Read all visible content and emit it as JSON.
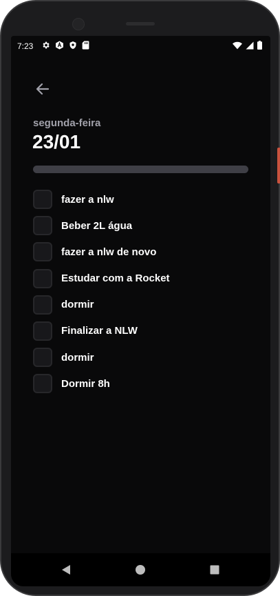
{
  "status_bar": {
    "time": "7:23",
    "left_icons": [
      "gear-icon",
      "a-badge-icon",
      "shield-icon",
      "sd-card-icon"
    ],
    "right_icons": [
      "wifi-icon",
      "signal-icon",
      "battery-icon"
    ]
  },
  "header": {
    "back_icon": "arrow-left-icon",
    "weekday": "segunda-feira",
    "date": "23/01"
  },
  "progress": {
    "value": 0,
    "track_color": "#3f3f46",
    "fill_color": "#7c3aed"
  },
  "habits": [
    {
      "label": "fazer a nlw",
      "checked": false
    },
    {
      "label": "Beber 2L água",
      "checked": false
    },
    {
      "label": "fazer a nlw de novo",
      "checked": false
    },
    {
      "label": "Estudar com a Rocket",
      "checked": false
    },
    {
      "label": "dormir",
      "checked": false
    },
    {
      "label": "Finalizar a NLW",
      "checked": false
    },
    {
      "label": "dormir",
      "checked": false
    },
    {
      "label": "Dormir 8h",
      "checked": false
    }
  ],
  "nav_bar": {
    "icons": [
      "back-triangle-icon",
      "home-circle-icon",
      "recents-square-icon"
    ]
  },
  "colors": {
    "background": "#09090a",
    "checkbox_bg": "#18181b",
    "checkbox_border": "#27272a",
    "weekday_text": "#a1a1aa",
    "device_accent": "#c9523e"
  }
}
